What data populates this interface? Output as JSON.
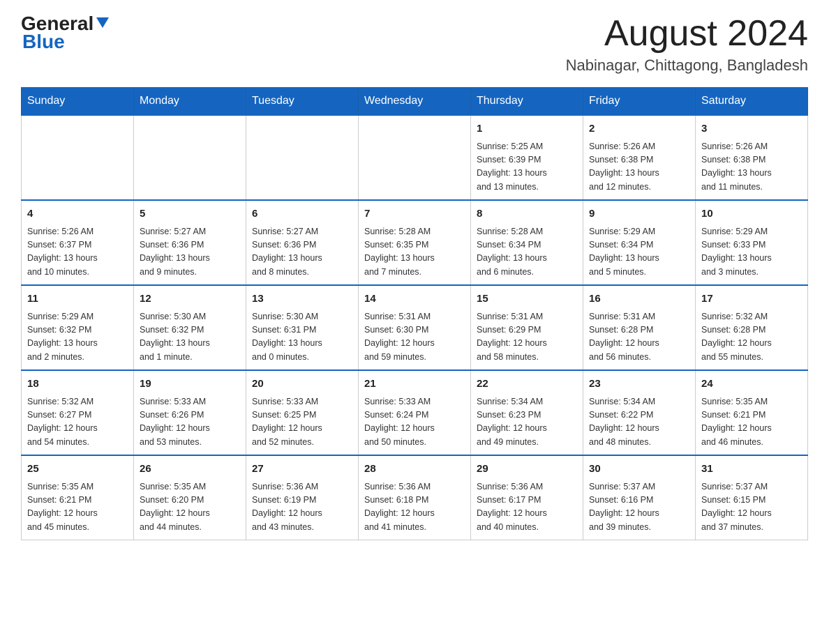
{
  "header": {
    "logo_text_black": "General",
    "logo_text_blue": "Blue",
    "month_title": "August 2024",
    "location": "Nabinagar, Chittagong, Bangladesh"
  },
  "calendar": {
    "days_of_week": [
      "Sunday",
      "Monday",
      "Tuesday",
      "Wednesday",
      "Thursday",
      "Friday",
      "Saturday"
    ],
    "weeks": [
      [
        {
          "day": "",
          "info": ""
        },
        {
          "day": "",
          "info": ""
        },
        {
          "day": "",
          "info": ""
        },
        {
          "day": "",
          "info": ""
        },
        {
          "day": "1",
          "info": "Sunrise: 5:25 AM\nSunset: 6:39 PM\nDaylight: 13 hours\nand 13 minutes."
        },
        {
          "day": "2",
          "info": "Sunrise: 5:26 AM\nSunset: 6:38 PM\nDaylight: 13 hours\nand 12 minutes."
        },
        {
          "day": "3",
          "info": "Sunrise: 5:26 AM\nSunset: 6:38 PM\nDaylight: 13 hours\nand 11 minutes."
        }
      ],
      [
        {
          "day": "4",
          "info": "Sunrise: 5:26 AM\nSunset: 6:37 PM\nDaylight: 13 hours\nand 10 minutes."
        },
        {
          "day": "5",
          "info": "Sunrise: 5:27 AM\nSunset: 6:36 PM\nDaylight: 13 hours\nand 9 minutes."
        },
        {
          "day": "6",
          "info": "Sunrise: 5:27 AM\nSunset: 6:36 PM\nDaylight: 13 hours\nand 8 minutes."
        },
        {
          "day": "7",
          "info": "Sunrise: 5:28 AM\nSunset: 6:35 PM\nDaylight: 13 hours\nand 7 minutes."
        },
        {
          "day": "8",
          "info": "Sunrise: 5:28 AM\nSunset: 6:34 PM\nDaylight: 13 hours\nand 6 minutes."
        },
        {
          "day": "9",
          "info": "Sunrise: 5:29 AM\nSunset: 6:34 PM\nDaylight: 13 hours\nand 5 minutes."
        },
        {
          "day": "10",
          "info": "Sunrise: 5:29 AM\nSunset: 6:33 PM\nDaylight: 13 hours\nand 3 minutes."
        }
      ],
      [
        {
          "day": "11",
          "info": "Sunrise: 5:29 AM\nSunset: 6:32 PM\nDaylight: 13 hours\nand 2 minutes."
        },
        {
          "day": "12",
          "info": "Sunrise: 5:30 AM\nSunset: 6:32 PM\nDaylight: 13 hours\nand 1 minute."
        },
        {
          "day": "13",
          "info": "Sunrise: 5:30 AM\nSunset: 6:31 PM\nDaylight: 13 hours\nand 0 minutes."
        },
        {
          "day": "14",
          "info": "Sunrise: 5:31 AM\nSunset: 6:30 PM\nDaylight: 12 hours\nand 59 minutes."
        },
        {
          "day": "15",
          "info": "Sunrise: 5:31 AM\nSunset: 6:29 PM\nDaylight: 12 hours\nand 58 minutes."
        },
        {
          "day": "16",
          "info": "Sunrise: 5:31 AM\nSunset: 6:28 PM\nDaylight: 12 hours\nand 56 minutes."
        },
        {
          "day": "17",
          "info": "Sunrise: 5:32 AM\nSunset: 6:28 PM\nDaylight: 12 hours\nand 55 minutes."
        }
      ],
      [
        {
          "day": "18",
          "info": "Sunrise: 5:32 AM\nSunset: 6:27 PM\nDaylight: 12 hours\nand 54 minutes."
        },
        {
          "day": "19",
          "info": "Sunrise: 5:33 AM\nSunset: 6:26 PM\nDaylight: 12 hours\nand 53 minutes."
        },
        {
          "day": "20",
          "info": "Sunrise: 5:33 AM\nSunset: 6:25 PM\nDaylight: 12 hours\nand 52 minutes."
        },
        {
          "day": "21",
          "info": "Sunrise: 5:33 AM\nSunset: 6:24 PM\nDaylight: 12 hours\nand 50 minutes."
        },
        {
          "day": "22",
          "info": "Sunrise: 5:34 AM\nSunset: 6:23 PM\nDaylight: 12 hours\nand 49 minutes."
        },
        {
          "day": "23",
          "info": "Sunrise: 5:34 AM\nSunset: 6:22 PM\nDaylight: 12 hours\nand 48 minutes."
        },
        {
          "day": "24",
          "info": "Sunrise: 5:35 AM\nSunset: 6:21 PM\nDaylight: 12 hours\nand 46 minutes."
        }
      ],
      [
        {
          "day": "25",
          "info": "Sunrise: 5:35 AM\nSunset: 6:21 PM\nDaylight: 12 hours\nand 45 minutes."
        },
        {
          "day": "26",
          "info": "Sunrise: 5:35 AM\nSunset: 6:20 PM\nDaylight: 12 hours\nand 44 minutes."
        },
        {
          "day": "27",
          "info": "Sunrise: 5:36 AM\nSunset: 6:19 PM\nDaylight: 12 hours\nand 43 minutes."
        },
        {
          "day": "28",
          "info": "Sunrise: 5:36 AM\nSunset: 6:18 PM\nDaylight: 12 hours\nand 41 minutes."
        },
        {
          "day": "29",
          "info": "Sunrise: 5:36 AM\nSunset: 6:17 PM\nDaylight: 12 hours\nand 40 minutes."
        },
        {
          "day": "30",
          "info": "Sunrise: 5:37 AM\nSunset: 6:16 PM\nDaylight: 12 hours\nand 39 minutes."
        },
        {
          "day": "31",
          "info": "Sunrise: 5:37 AM\nSunset: 6:15 PM\nDaylight: 12 hours\nand 37 minutes."
        }
      ]
    ]
  }
}
